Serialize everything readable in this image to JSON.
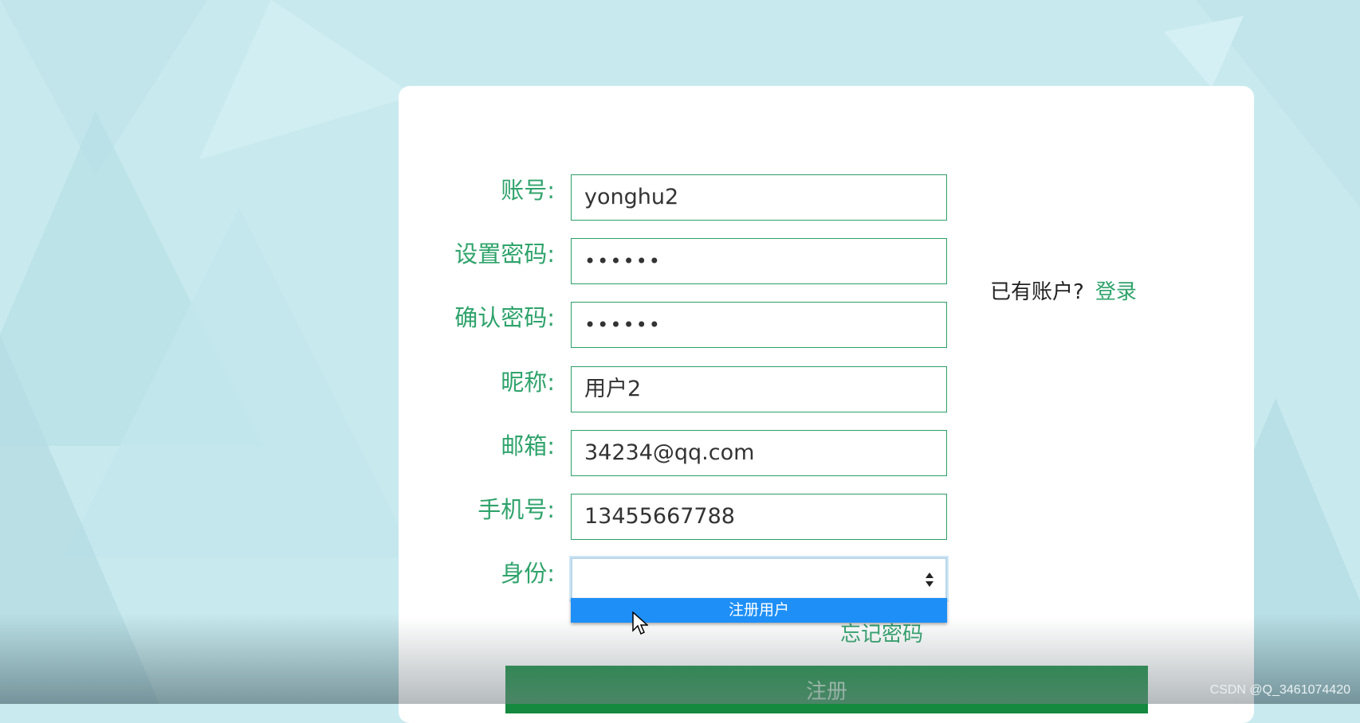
{
  "form": {
    "fields": [
      {
        "label": "账号:",
        "value": "yonghu2",
        "type": "text"
      },
      {
        "label": "设置密码:",
        "value": "••••••",
        "type": "password"
      },
      {
        "label": "确认密码:",
        "value": "••••••",
        "type": "password"
      },
      {
        "label": "昵称:",
        "value": "用户2",
        "type": "text"
      },
      {
        "label": "邮箱:",
        "value": "34234@qq.com",
        "type": "text"
      },
      {
        "label": "手机号:",
        "value": "13455667788",
        "type": "text"
      }
    ],
    "identity": {
      "label": "身份:",
      "selected": "",
      "options": [
        "注册用户"
      ]
    },
    "forgot_label": "忘记密码",
    "submit_label": "注册"
  },
  "login_hint": {
    "text": "已有账户?",
    "link": "登录"
  },
  "watermark": "CSDN @Q_3461074420",
  "colors": {
    "accent": "#2fa36b",
    "button": "#14893f",
    "dropdown_highlight": "#1e8ff7"
  }
}
